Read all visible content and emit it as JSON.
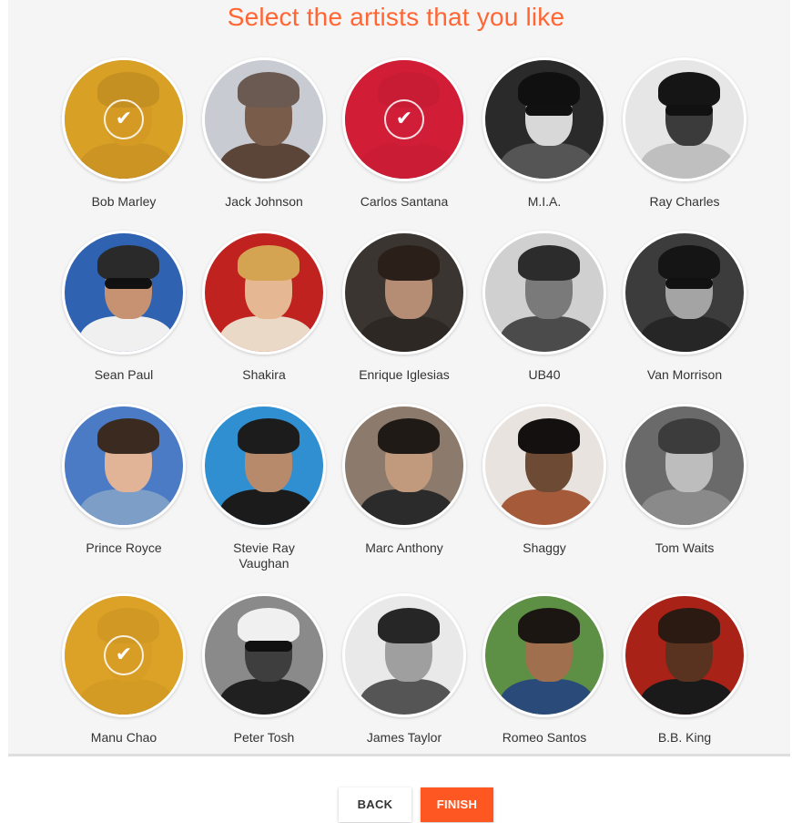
{
  "header": {
    "title": "Select the artists that you like"
  },
  "artists": [
    {
      "name": "Bob Marley",
      "selected": true,
      "overlay_color": "#e0a526",
      "photo": {
        "bg": "#b58a2a",
        "skin": "#9a6b1f",
        "hair": "#4a3512",
        "torso": "#6e4c16",
        "shades": false
      }
    },
    {
      "name": "Jack Johnson",
      "selected": false,
      "photo": {
        "bg": "#c9cbd3",
        "skin": "#7a5c4a",
        "hair": "#6b5a52",
        "torso": "#5a4538",
        "shades": false
      }
    },
    {
      "name": "Carlos Santana",
      "selected": true,
      "overlay_color": "#d9203a",
      "photo": {
        "bg": "#b3122a",
        "skin": "#a81a30",
        "hair": "#7d0e1f",
        "torso": "#8c0f22",
        "shades": false
      }
    },
    {
      "name": "M.I.A.",
      "selected": false,
      "photo": {
        "bg": "#2a2a2a",
        "skin": "#d8d8d8",
        "hair": "#101010",
        "torso": "#555555",
        "shades": true
      }
    },
    {
      "name": "Ray Charles",
      "selected": false,
      "photo": {
        "bg": "#e6e6e6",
        "skin": "#3b3b3b",
        "hair": "#151515",
        "torso": "#bfbfbf",
        "shades": true
      }
    },
    {
      "name": "Sean Paul",
      "selected": false,
      "photo": {
        "bg": "#2f62b0",
        "skin": "#c79272",
        "hair": "#2a2a2a",
        "torso": "#f0f0f0",
        "shades": true
      }
    },
    {
      "name": "Shakira",
      "selected": false,
      "photo": {
        "bg": "#c0231f",
        "skin": "#e5b792",
        "hair": "#d4a452",
        "torso": "#ead9c6",
        "shades": false
      }
    },
    {
      "name": "Enrique Iglesias",
      "selected": false,
      "photo": {
        "bg": "#3a3530",
        "skin": "#b48d74",
        "hair": "#2a2019",
        "torso": "#2d2824",
        "shades": false
      }
    },
    {
      "name": "UB40",
      "selected": false,
      "photo": {
        "bg": "#d0d0d0",
        "skin": "#7a7a7a",
        "hair": "#2c2c2c",
        "torso": "#4b4b4b",
        "shades": false
      }
    },
    {
      "name": "Van Morrison",
      "selected": false,
      "photo": {
        "bg": "#3c3c3c",
        "skin": "#a4a4a4",
        "hair": "#151515",
        "torso": "#262626",
        "shades": true
      }
    },
    {
      "name": "Prince Royce",
      "selected": false,
      "photo": {
        "bg": "#4b7bc4",
        "skin": "#e1b497",
        "hair": "#3a2a1f",
        "torso": "#7d9ec7",
        "shades": false
      }
    },
    {
      "name": "Stevie Ray\nVaughan",
      "selected": false,
      "photo": {
        "bg": "#2f8fd0",
        "skin": "#b88a6c",
        "hair": "#1c1c1c",
        "torso": "#1b1b1b",
        "shades": false
      }
    },
    {
      "name": "Marc Anthony",
      "selected": false,
      "photo": {
        "bg": "#8c7b6c",
        "skin": "#c19a7e",
        "hair": "#1f1a16",
        "torso": "#2b2b2b",
        "shades": false
      }
    },
    {
      "name": "Shaggy",
      "selected": false,
      "photo": {
        "bg": "#e8e3de",
        "skin": "#6d4a33",
        "hair": "#141010",
        "torso": "#a55a3a",
        "shades": false
      }
    },
    {
      "name": "Tom Waits",
      "selected": false,
      "photo": {
        "bg": "#6a6a6a",
        "skin": "#bdbdbd",
        "hair": "#3c3c3c",
        "torso": "#8a8a8a",
        "shades": false
      }
    },
    {
      "name": "Manu Chao",
      "selected": true,
      "overlay_color": "#e0a526",
      "photo": {
        "bg": "#c79431",
        "skin": "#b07d22",
        "hair": "#8a6218",
        "torso": "#9c7020",
        "shades": false
      }
    },
    {
      "name": "Peter Tosh",
      "selected": false,
      "photo": {
        "bg": "#8a8a8a",
        "skin": "#3e3e3e",
        "hair": "#f0f0f0",
        "torso": "#202020",
        "shades": true
      }
    },
    {
      "name": "James Taylor",
      "selected": false,
      "photo": {
        "bg": "#e9e9e9",
        "skin": "#9f9f9f",
        "hair": "#262626",
        "torso": "#555555",
        "shades": false
      }
    },
    {
      "name": "Romeo Santos",
      "selected": false,
      "photo": {
        "bg": "#5d8f45",
        "skin": "#a0704e",
        "hair": "#1c1612",
        "torso": "#2a4a7a",
        "shades": false
      }
    },
    {
      "name": "B.B. King",
      "selected": false,
      "photo": {
        "bg": "#a82218",
        "skin": "#5a3220",
        "hair": "#2a1a12",
        "torso": "#1a1a1a",
        "shades": false
      }
    }
  ],
  "footer": {
    "back_label": "BACK",
    "finish_label": "FINISH"
  }
}
